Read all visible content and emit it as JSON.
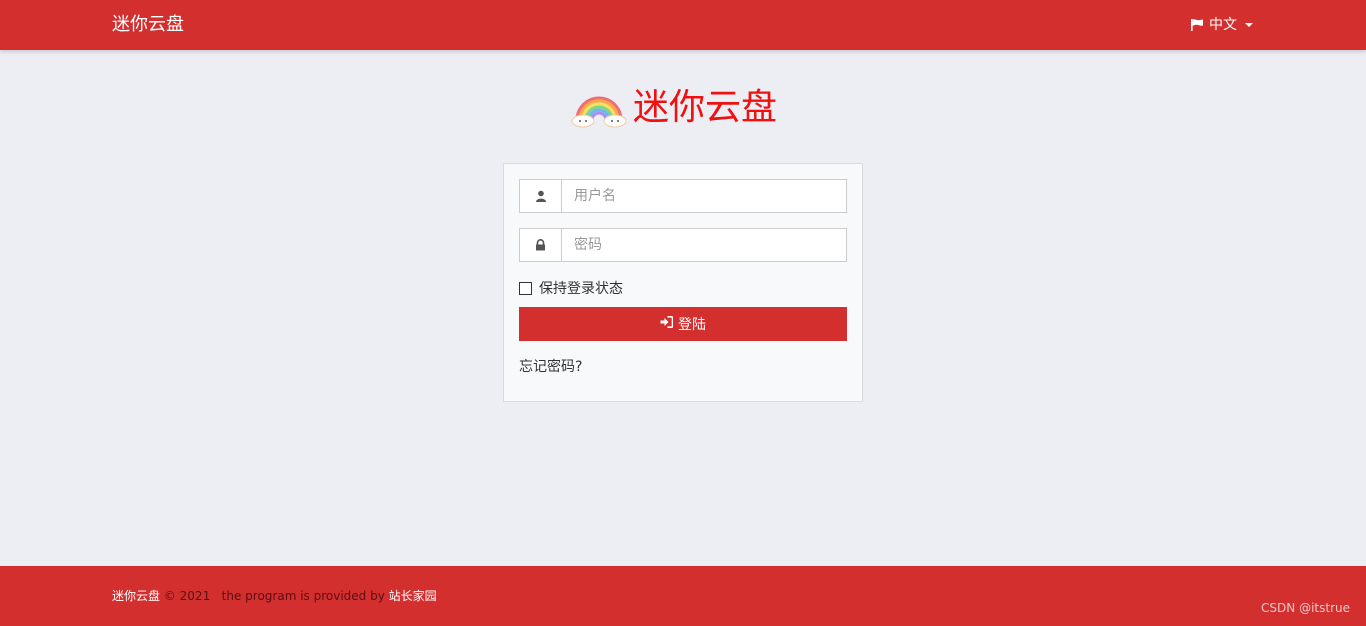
{
  "header": {
    "brand": "迷你云盘",
    "language_label": "中文"
  },
  "logo": {
    "title": "迷你云盘"
  },
  "login": {
    "username_placeholder": "用户名",
    "password_placeholder": "密码",
    "remember_label": "保持登录状态",
    "submit_label": "登陆",
    "forgot_label": "忘记密码?"
  },
  "footer": {
    "brand": "迷你云盘",
    "copyright": "© 2021",
    "provided_text": "the program is provided by",
    "provider": "站长家园",
    "watermark": "CSDN @itstrue"
  },
  "colors": {
    "primary": "#d32f2f",
    "background": "#eceef3",
    "logo_text": "#f01010"
  },
  "icons": [
    "flag-icon",
    "rainbow-logo-icon",
    "user-icon",
    "lock-icon",
    "sign-in-icon"
  ]
}
